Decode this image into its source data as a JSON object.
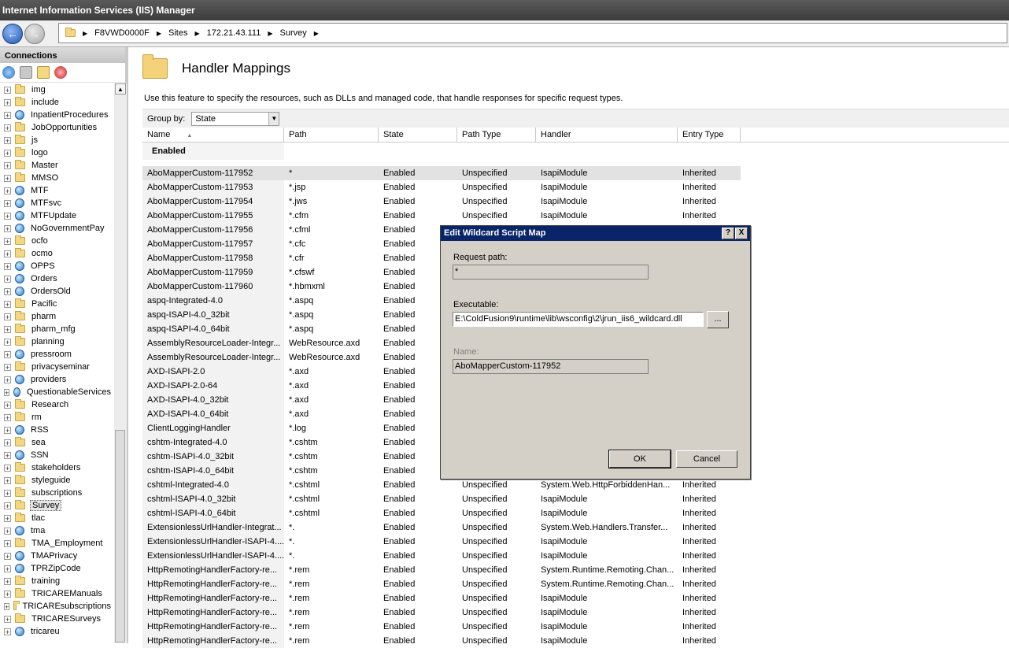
{
  "window": {
    "title": "Internet Information Services (IIS) Manager"
  },
  "address": {
    "crumbs": [
      "F8VWD0000F",
      "Sites",
      "172.21.43.111",
      "Survey"
    ]
  },
  "connections": {
    "title": "Connections",
    "tree": [
      {
        "label": "img",
        "icon": "folder-icon"
      },
      {
        "label": "include",
        "icon": "folder-icon"
      },
      {
        "label": "InpatientProcedures",
        "icon": "globe-icon"
      },
      {
        "label": "JobOpportunities",
        "icon": "folder-icon"
      },
      {
        "label": "js",
        "icon": "folder-icon"
      },
      {
        "label": "logo",
        "icon": "folder-icon"
      },
      {
        "label": "Master",
        "icon": "folder-icon"
      },
      {
        "label": "MMSO",
        "icon": "folder-icon"
      },
      {
        "label": "MTF",
        "icon": "globe-icon"
      },
      {
        "label": "MTFsvc",
        "icon": "globe-icon"
      },
      {
        "label": "MTFUpdate",
        "icon": "globe-icon"
      },
      {
        "label": "NoGovernmentPay",
        "icon": "globe-icon"
      },
      {
        "label": "ocfo",
        "icon": "folder-icon"
      },
      {
        "label": "ocmo",
        "icon": "folder-icon"
      },
      {
        "label": "OPPS",
        "icon": "globe-icon"
      },
      {
        "label": "Orders",
        "icon": "globe-icon"
      },
      {
        "label": "OrdersOld",
        "icon": "globe-icon"
      },
      {
        "label": "Pacific",
        "icon": "folder-icon"
      },
      {
        "label": "pharm",
        "icon": "folder-icon"
      },
      {
        "label": "pharm_mfg",
        "icon": "folder-icon"
      },
      {
        "label": "planning",
        "icon": "folder-icon"
      },
      {
        "label": "pressroom",
        "icon": "globe-icon"
      },
      {
        "label": "privacyseminar",
        "icon": "folder-icon"
      },
      {
        "label": "providers",
        "icon": "globe-icon"
      },
      {
        "label": "QuestionableServices",
        "icon": "globe-icon"
      },
      {
        "label": "Research",
        "icon": "folder-icon"
      },
      {
        "label": "rm",
        "icon": "folder-icon"
      },
      {
        "label": "RSS",
        "icon": "globe-icon"
      },
      {
        "label": "sea",
        "icon": "folder-icon"
      },
      {
        "label": "SSN",
        "icon": "globe-icon"
      },
      {
        "label": "stakeholders",
        "icon": "folder-icon"
      },
      {
        "label": "styleguide",
        "icon": "folder-icon"
      },
      {
        "label": "subscriptions",
        "icon": "folder-icon"
      },
      {
        "label": "Survey",
        "icon": "folder-icon",
        "selected": true
      },
      {
        "label": "tlac",
        "icon": "folder-icon"
      },
      {
        "label": "tma",
        "icon": "globe-icon"
      },
      {
        "label": "TMA_Employment",
        "icon": "folder-icon"
      },
      {
        "label": "TMAPrivacy",
        "icon": "globe-icon"
      },
      {
        "label": "TPRZipCode",
        "icon": "globe-icon"
      },
      {
        "label": "training",
        "icon": "folder-icon"
      },
      {
        "label": "TRICAREManuals",
        "icon": "folder-icon"
      },
      {
        "label": "TRICAREsubscriptions",
        "icon": "folder-icon"
      },
      {
        "label": "TRICARESurveys",
        "icon": "folder-icon"
      },
      {
        "label": "tricareu",
        "icon": "globe-icon"
      }
    ]
  },
  "feature": {
    "title": "Handler Mappings",
    "description": "Use this feature to specify the resources, such as DLLs and managed code, that handle responses for specific request types.",
    "group_by_label": "Group by:",
    "group_by_value": "State",
    "columns": [
      "Name",
      "Path",
      "State",
      "Path Type",
      "Handler",
      "Entry Type"
    ],
    "group_header": "Enabled",
    "rows": [
      [
        "AboMapperCustom-117952",
        "*",
        "Enabled",
        "Unspecified",
        "IsapiModule",
        "Inherited"
      ],
      [
        "AboMapperCustom-117953",
        "*.jsp",
        "Enabled",
        "Unspecified",
        "IsapiModule",
        "Inherited"
      ],
      [
        "AboMapperCustom-117954",
        "*.jws",
        "Enabled",
        "Unspecified",
        "IsapiModule",
        "Inherited"
      ],
      [
        "AboMapperCustom-117955",
        "*.cfm",
        "Enabled",
        "Unspecified",
        "IsapiModule",
        "Inherited"
      ],
      [
        "AboMapperCustom-117956",
        "*.cfml",
        "Enabled",
        "",
        "",
        ""
      ],
      [
        "AboMapperCustom-117957",
        "*.cfc",
        "Enabled",
        "",
        "",
        ""
      ],
      [
        "AboMapperCustom-117958",
        "*.cfr",
        "Enabled",
        "",
        "",
        ""
      ],
      [
        "AboMapperCustom-117959",
        "*.cfswf",
        "Enabled",
        "",
        "",
        ""
      ],
      [
        "AboMapperCustom-117960",
        "*.hbmxml",
        "Enabled",
        "",
        "",
        ""
      ],
      [
        "aspq-Integrated-4.0",
        "*.aspq",
        "Enabled",
        "",
        "",
        ""
      ],
      [
        "aspq-ISAPI-4.0_32bit",
        "*.aspq",
        "Enabled",
        "",
        "",
        ""
      ],
      [
        "aspq-ISAPI-4.0_64bit",
        "*.aspq",
        "Enabled",
        "",
        "",
        ""
      ],
      [
        "AssemblyResourceLoader-Integr...",
        "WebResource.axd",
        "Enabled",
        "",
        "",
        ""
      ],
      [
        "AssemblyResourceLoader-Integr...",
        "WebResource.axd",
        "Enabled",
        "",
        "",
        ""
      ],
      [
        "AXD-ISAPI-2.0",
        "*.axd",
        "Enabled",
        "",
        "",
        ""
      ],
      [
        "AXD-ISAPI-2.0-64",
        "*.axd",
        "Enabled",
        "",
        "",
        ""
      ],
      [
        "AXD-ISAPI-4.0_32bit",
        "*.axd",
        "Enabled",
        "",
        "",
        ""
      ],
      [
        "AXD-ISAPI-4.0_64bit",
        "*.axd",
        "Enabled",
        "",
        "",
        ""
      ],
      [
        "ClientLoggingHandler",
        "*.log",
        "Enabled",
        "",
        "",
        ""
      ],
      [
        "cshtm-Integrated-4.0",
        "*.cshtm",
        "Enabled",
        "",
        "",
        ""
      ],
      [
        "cshtm-ISAPI-4.0_32bit",
        "*.cshtm",
        "Enabled",
        "",
        "",
        ""
      ],
      [
        "cshtm-ISAPI-4.0_64bit",
        "*.cshtm",
        "Enabled",
        "",
        "",
        ""
      ],
      [
        "cshtml-Integrated-4.0",
        "*.cshtml",
        "Enabled",
        "Unspecified",
        "System.Web.HttpForbiddenHan...",
        "Inherited"
      ],
      [
        "cshtml-ISAPI-4.0_32bit",
        "*.cshtml",
        "Enabled",
        "Unspecified",
        "IsapiModule",
        "Inherited"
      ],
      [
        "cshtml-ISAPI-4.0_64bit",
        "*.cshtml",
        "Enabled",
        "Unspecified",
        "IsapiModule",
        "Inherited"
      ],
      [
        "ExtensionlessUrlHandler-Integrat...",
        "*.",
        "Enabled",
        "Unspecified",
        "System.Web.Handlers.Transfer...",
        "Inherited"
      ],
      [
        "ExtensionlessUrlHandler-ISAPI-4....",
        "*.",
        "Enabled",
        "Unspecified",
        "IsapiModule",
        "Inherited"
      ],
      [
        "ExtensionlessUrlHandler-ISAPI-4....",
        "*.",
        "Enabled",
        "Unspecified",
        "IsapiModule",
        "Inherited"
      ],
      [
        "HttpRemotingHandlerFactory-re...",
        "*.rem",
        "Enabled",
        "Unspecified",
        "System.Runtime.Remoting.Chan...",
        "Inherited"
      ],
      [
        "HttpRemotingHandlerFactory-re...",
        "*.rem",
        "Enabled",
        "Unspecified",
        "System.Runtime.Remoting.Chan...",
        "Inherited"
      ],
      [
        "HttpRemotingHandlerFactory-re...",
        "*.rem",
        "Enabled",
        "Unspecified",
        "IsapiModule",
        "Inherited"
      ],
      [
        "HttpRemotingHandlerFactory-re...",
        "*.rem",
        "Enabled",
        "Unspecified",
        "IsapiModule",
        "Inherited"
      ],
      [
        "HttpRemotingHandlerFactory-re...",
        "*.rem",
        "Enabled",
        "Unspecified",
        "IsapiModule",
        "Inherited"
      ],
      [
        "HttpRemotingHandlerFactory-re...",
        "*.rem",
        "Enabled",
        "Unspecified",
        "IsapiModule",
        "Inherited"
      ]
    ]
  },
  "dialog": {
    "title": "Edit Wildcard Script Map",
    "help_glyph": "?",
    "close_glyph": "X",
    "request_path_label": "Request path:",
    "request_path_value": "*",
    "executable_label": "Executable:",
    "executable_value": "E:\\ColdFusion9\\runtime\\lib\\wsconfig\\2\\jrun_iis6_wildcard.dll",
    "browse_label": "...",
    "name_label": "Name:",
    "name_value": "AboMapperCustom-117952",
    "ok_label": "OK",
    "cancel_label": "Cancel"
  }
}
